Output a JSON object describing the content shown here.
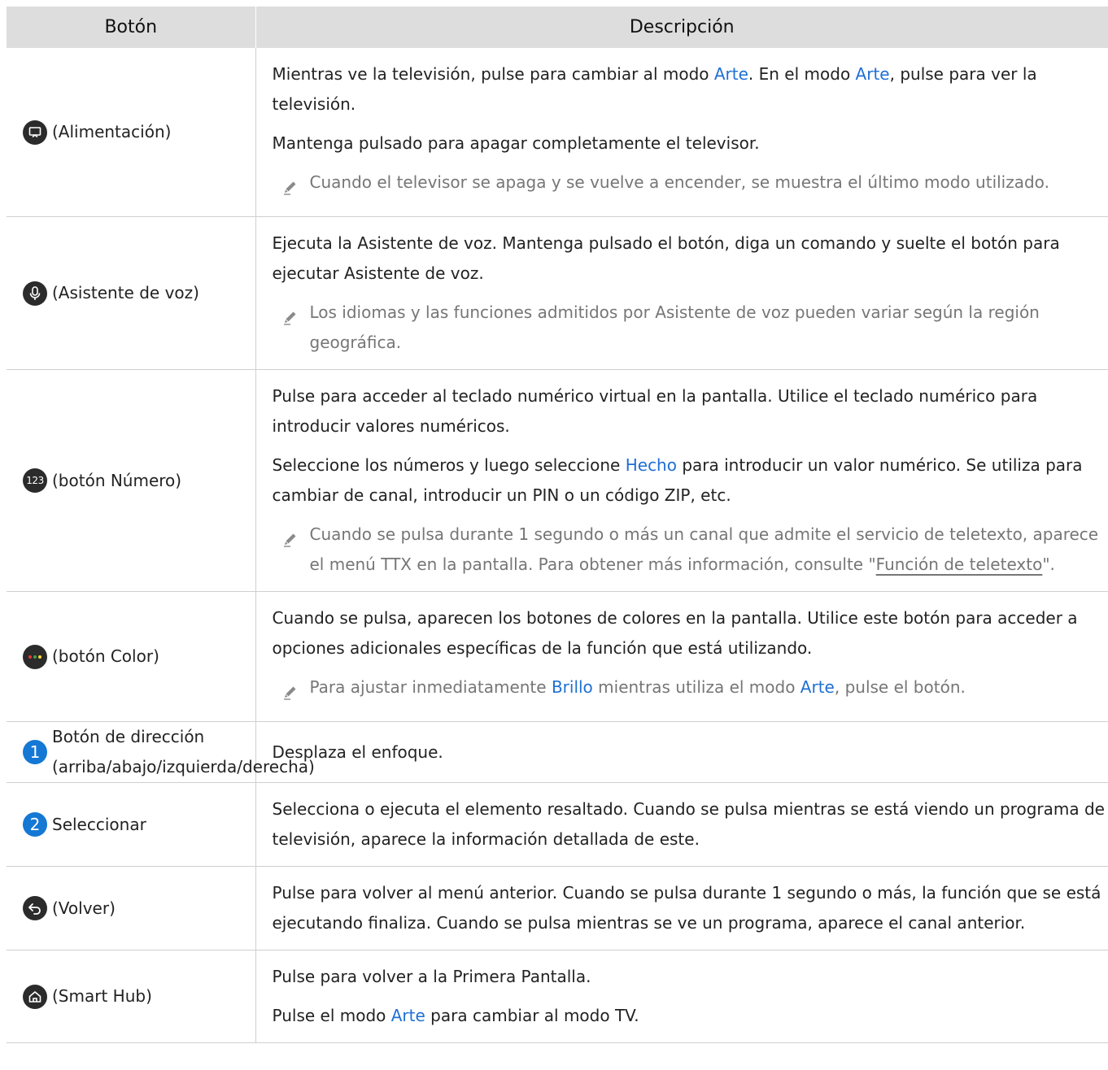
{
  "header": {
    "col1": "Botón",
    "col2": "Descripción"
  },
  "rows": [
    {
      "label": "(Alimentación)",
      "icon": "art-mode-icon",
      "desc": [
        {
          "parts": [
            "Mientras ve la televisión, pulse para cambiar al modo ",
            "Arte",
            ". En el modo ",
            "Arte",
            ", pulse para ver la televisión."
          ]
        },
        {
          "parts": [
            "Mantenga pulsado para apagar completamente el televisor."
          ]
        }
      ],
      "notes": [
        {
          "parts": [
            "Cuando el televisor se apaga y se vuelve a encender, se muestra el último modo utilizado."
          ]
        }
      ]
    },
    {
      "label": "(Asistente de voz)",
      "icon": "microphone-icon",
      "desc": [
        {
          "parts": [
            "Ejecuta la Asistente de voz. Mantenga pulsado el botón, diga un comando y suelte el botón para ejecutar Asistente de voz."
          ]
        }
      ],
      "notes": [
        {
          "parts": [
            "Los idiomas y las funciones admitidos por Asistente de voz pueden variar según la región geográfica."
          ]
        }
      ]
    },
    {
      "label": "(botón Número)",
      "icon": "number-123-icon",
      "icon_text": "123",
      "desc": [
        {
          "parts": [
            "Pulse para acceder al teclado numérico virtual en la pantalla. Utilice el teclado numérico para introducir valores numéricos."
          ]
        },
        {
          "parts": [
            "Seleccione los números y luego seleccione ",
            "Hecho",
            " para introducir un valor numérico. Se utiliza para cambiar de canal, introducir un PIN o un código ZIP, etc."
          ]
        }
      ],
      "notes": [
        {
          "parts": [
            "Cuando se pulsa durante 1 segundo o más un canal que admite el servicio de teletexto, aparece el menú TTX en la pantalla. Para obtener más información, consulte \"",
            "Función de teletexto",
            "\"."
          ]
        }
      ]
    },
    {
      "label": "(botón Color)",
      "icon": "color-buttons-icon",
      "desc": [
        {
          "parts": [
            "Cuando se pulsa, aparecen los botones de colores en la pantalla. Utilice este botón para acceder a opciones adicionales específicas de la función que está utilizando."
          ]
        }
      ],
      "notes": [
        {
          "parts": [
            "Para ajustar inmediatamente ",
            "Brillo",
            " mientras utiliza el modo ",
            "Arte",
            ", pulse el botón."
          ]
        }
      ]
    },
    {
      "label": "Botón de dirección (arriba/abajo/izquierda/derecha)",
      "number": "1",
      "desc": [
        {
          "parts": [
            "Desplaza el enfoque."
          ]
        }
      ],
      "notes": []
    },
    {
      "label": "Seleccionar",
      "number": "2",
      "desc": [
        {
          "parts": [
            "Selecciona o ejecuta el elemento resaltado. Cuando se pulsa mientras se está viendo un programa de televisión, aparece la información detallada de este."
          ]
        }
      ],
      "notes": []
    },
    {
      "label": "(Volver)",
      "icon": "return-icon",
      "desc": [
        {
          "parts": [
            "Pulse para volver al menú anterior. Cuando se pulsa durante 1 segundo o más, la función que se está ejecutando finaliza. Cuando se pulsa mientras se ve un programa, aparece el canal anterior."
          ]
        }
      ],
      "notes": []
    },
    {
      "label": "(Smart Hub)",
      "icon": "home-icon",
      "desc": [
        {
          "parts": [
            "Pulse para volver a la Primera Pantalla."
          ]
        },
        {
          "parts": [
            "Pulse el modo ",
            "Arte",
            " para cambiar al modo TV."
          ]
        }
      ],
      "notes": []
    }
  ],
  "colors": {
    "header_bg": "#dddddd",
    "link_blue": "#1f6fd4",
    "note_gray": "#767676",
    "number_badge": "#1478d4"
  }
}
